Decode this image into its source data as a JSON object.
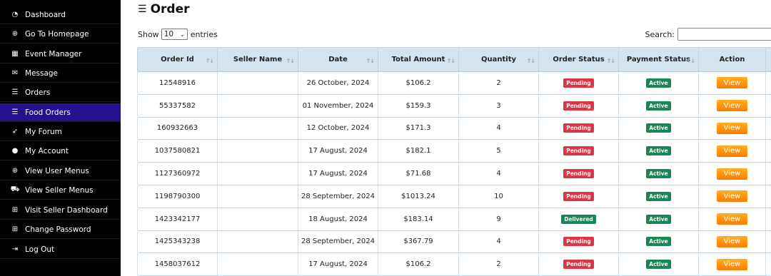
{
  "sidebar": {
    "items": [
      {
        "label": "Dashboard",
        "icon": "dashboard-icon",
        "glyph": "◔"
      },
      {
        "label": "Go To Homepage",
        "icon": "globe-icon",
        "glyph": "⊕"
      },
      {
        "label": "Event Manager",
        "icon": "calendar-icon",
        "glyph": "▦"
      },
      {
        "label": "Message",
        "icon": "envelope-icon",
        "glyph": "✉"
      },
      {
        "label": "Orders",
        "icon": "list-icon",
        "glyph": "☰"
      },
      {
        "label": "Food Orders",
        "icon": "list-icon",
        "glyph": "☰"
      },
      {
        "label": "My Forum",
        "icon": "forum-icon",
        "glyph": "➶"
      },
      {
        "label": "My Account",
        "icon": "user-icon",
        "glyph": "●"
      },
      {
        "label": "View User Menus",
        "icon": "globe-icon",
        "glyph": "⊕"
      },
      {
        "label": "View Seller Menus",
        "icon": "truck-icon",
        "glyph": "⛟"
      },
      {
        "label": "Visit Seller Dashboard",
        "icon": "gift-icon",
        "glyph": "⊞"
      },
      {
        "label": "Change Password",
        "icon": "gift-icon",
        "glyph": "⊞"
      },
      {
        "label": "Log Out",
        "icon": "logout-icon",
        "glyph": "⇥"
      }
    ],
    "active_index": 5,
    "active_color": "#25108f"
  },
  "main": {
    "title": "Order",
    "show_label": "Show",
    "entries_value": "10",
    "entries_label": "entries",
    "search_label": "Search:",
    "search_value": ""
  },
  "table": {
    "columns": [
      "Order Id",
      "Seller Name",
      "Date",
      "Total Amount",
      "Quantity",
      "Order Status",
      "Payment Status",
      "Action"
    ],
    "rows": [
      {
        "order_id": "12548916",
        "seller": "",
        "date": "26 October, 2024",
        "amount": "$106.2",
        "qty": "2",
        "status": "Pending",
        "payment": "Active",
        "action": "View"
      },
      {
        "order_id": "55337582",
        "seller": "",
        "date": "01 November, 2024",
        "amount": "$159.3",
        "qty": "3",
        "status": "Pending",
        "payment": "Active",
        "action": "View"
      },
      {
        "order_id": "160932663",
        "seller": "",
        "date": "12 October, 2024",
        "amount": "$171.3",
        "qty": "4",
        "status": "Pending",
        "payment": "Active",
        "action": "View"
      },
      {
        "order_id": "1037580821",
        "seller": "",
        "date": "17 August, 2024",
        "amount": "$182.1",
        "qty": "5",
        "status": "Pending",
        "payment": "Active",
        "action": "View"
      },
      {
        "order_id": "1127360972",
        "seller": "",
        "date": "17 August, 2024",
        "amount": "$71.68",
        "qty": "4",
        "status": "Pending",
        "payment": "Active",
        "action": "View"
      },
      {
        "order_id": "1198790300",
        "seller": "",
        "date": "28 September, 2024",
        "amount": "$1013.24",
        "qty": "10",
        "status": "Pending",
        "payment": "Active",
        "action": "View"
      },
      {
        "order_id": "1423342177",
        "seller": "",
        "date": "18 August, 2024",
        "amount": "$183.14",
        "qty": "9",
        "status": "Delivered",
        "payment": "Active",
        "action": "View"
      },
      {
        "order_id": "1425343238",
        "seller": "",
        "date": "28 September, 2024",
        "amount": "$367.79",
        "qty": "4",
        "status": "Pending",
        "payment": "Active",
        "action": "View"
      },
      {
        "order_id": "1458037612",
        "seller": "",
        "date": "17 August, 2024",
        "amount": "$106.2",
        "qty": "2",
        "status": "Pending",
        "payment": "Active",
        "action": "View"
      }
    ]
  },
  "colors": {
    "pending": "#dc3545",
    "delivered": "#198754",
    "active": "#198754",
    "view_button": "#ff8c00",
    "header_bg": "#d4e4ef"
  }
}
